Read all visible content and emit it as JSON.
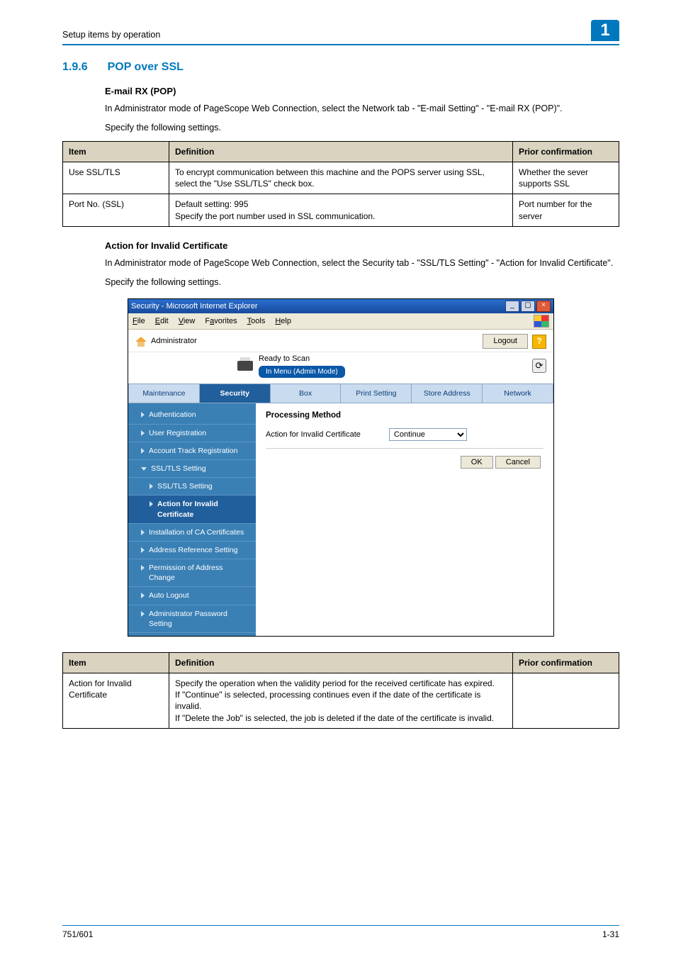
{
  "header": {
    "running": "Setup items by operation",
    "chapter_badge": "1"
  },
  "section": {
    "number": "1.9.6",
    "title": "POP over SSL"
  },
  "sub1": {
    "title": "E-mail RX (POP)",
    "para1": "In Administrator mode of PageScope Web Connection, select the Network tab - \"E-mail Setting\" - \"E-mail RX (POP)\".",
    "para2": "Specify the following settings."
  },
  "table1": {
    "h_item": "Item",
    "h_def": "Definition",
    "h_prior": "Prior confirmation",
    "rows": [
      {
        "item": "Use SSL/TLS",
        "def": "To encrypt communication between this machine and the POPS server using SSL, select the \"Use SSL/TLS\" check box.",
        "prior": "Whether the sever supports SSL"
      },
      {
        "item": "Port No. (SSL)",
        "def": "Default setting: 995\nSpecify the port number used in SSL communication.",
        "prior": "Port number for the server"
      }
    ]
  },
  "sub2": {
    "title": "Action for Invalid Certificate",
    "para1": "In Administrator mode of PageScope Web Connection, select the Security tab - \"SSL/TLS Setting\" - \"Action for Invalid Certificate\".",
    "para2": "Specify the following settings."
  },
  "shot": {
    "window_title": "Security - Microsoft Internet Explorer",
    "menu": {
      "file": "File",
      "edit": "Edit",
      "view": "View",
      "favorites": "Favorites",
      "tools": "Tools",
      "help": "Help"
    },
    "admin_label": "Administrator",
    "logout": "Logout",
    "help_q": "?",
    "ready": "Ready to Scan",
    "mode_badge": "In Menu (Admin Mode)",
    "refresh_glyph": "⟳",
    "tabs": {
      "maintenance": "Maintenance",
      "security": "Security",
      "box": "Box",
      "print": "Print Setting",
      "store": "Store Address",
      "network": "Network"
    },
    "side": {
      "auth": "Authentication",
      "user_reg": "User Registration",
      "acct_track": "Account Track Registration",
      "ssl_setting": "SSL/TLS Setting",
      "ssl_sub": "SSL/TLS Setting",
      "action_invalid": "Action for Invalid Certificate",
      "install_ca": "Installation of CA Certificates",
      "addr_ref": "Address Reference Setting",
      "perm_addr": "Permission of Address Change",
      "auto_logout": "Auto Logout",
      "admin_pw": "Administrator Password Setting"
    },
    "main": {
      "heading": "Processing Method",
      "field_label": "Action for Invalid Certificate",
      "select_value": "Continue",
      "ok": "OK",
      "cancel": "Cancel"
    }
  },
  "table2": {
    "h_item": "Item",
    "h_def": "Definition",
    "h_prior": "Prior confirmation",
    "rows": [
      {
        "item": "Action for Invalid Certificate",
        "def": "Specify the operation when the validity period for the received certificate has expired.\nIf \"Continue\" is selected, processing continues even if the date of the certificate is invalid.\nIf \"Delete the Job\" is selected, the job is deleted if the date of the certificate is invalid.",
        "prior": ""
      }
    ]
  },
  "footer": {
    "left": "751/601",
    "right": "1-31"
  }
}
